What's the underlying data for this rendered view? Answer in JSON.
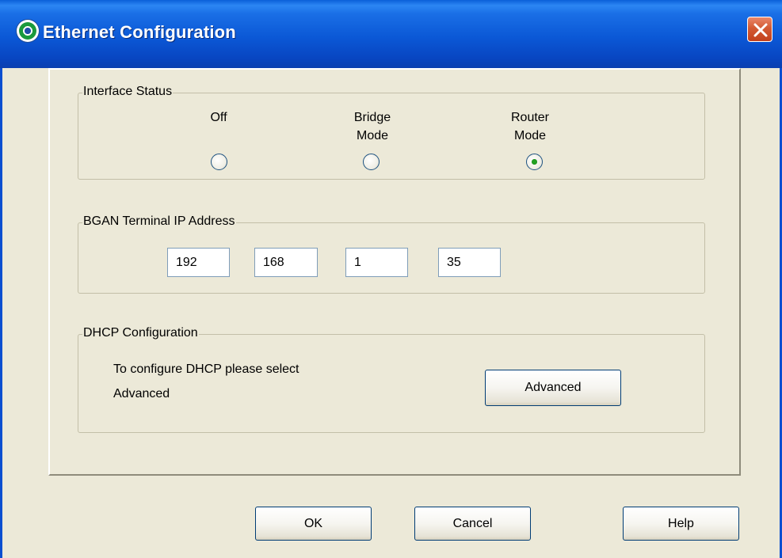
{
  "window": {
    "title": "Ethernet Configuration"
  },
  "interface_status": {
    "legend": "Interface Status",
    "options": [
      {
        "label_line1": "Off",
        "label_line2": "",
        "selected": false
      },
      {
        "label_line1": "Bridge",
        "label_line2": "Mode",
        "selected": false
      },
      {
        "label_line1": "Router",
        "label_line2": "Mode",
        "selected": true
      }
    ]
  },
  "ip_address": {
    "legend": "BGAN Terminal IP Address",
    "octets": [
      "192",
      "168",
      "1",
      "35"
    ]
  },
  "dhcp": {
    "legend": "DHCP Configuration",
    "text_line1": "To configure DHCP please select",
    "text_line2": "Advanced",
    "advanced_label": "Advanced"
  },
  "footer": {
    "ok_label": "OK",
    "cancel_label": "Cancel",
    "help_label": "Help"
  },
  "colors": {
    "titlebar": "#0b58d6",
    "dialog_bg": "#ece9d8",
    "close_button": "#d35a34",
    "radio_dot": "#21a121"
  }
}
